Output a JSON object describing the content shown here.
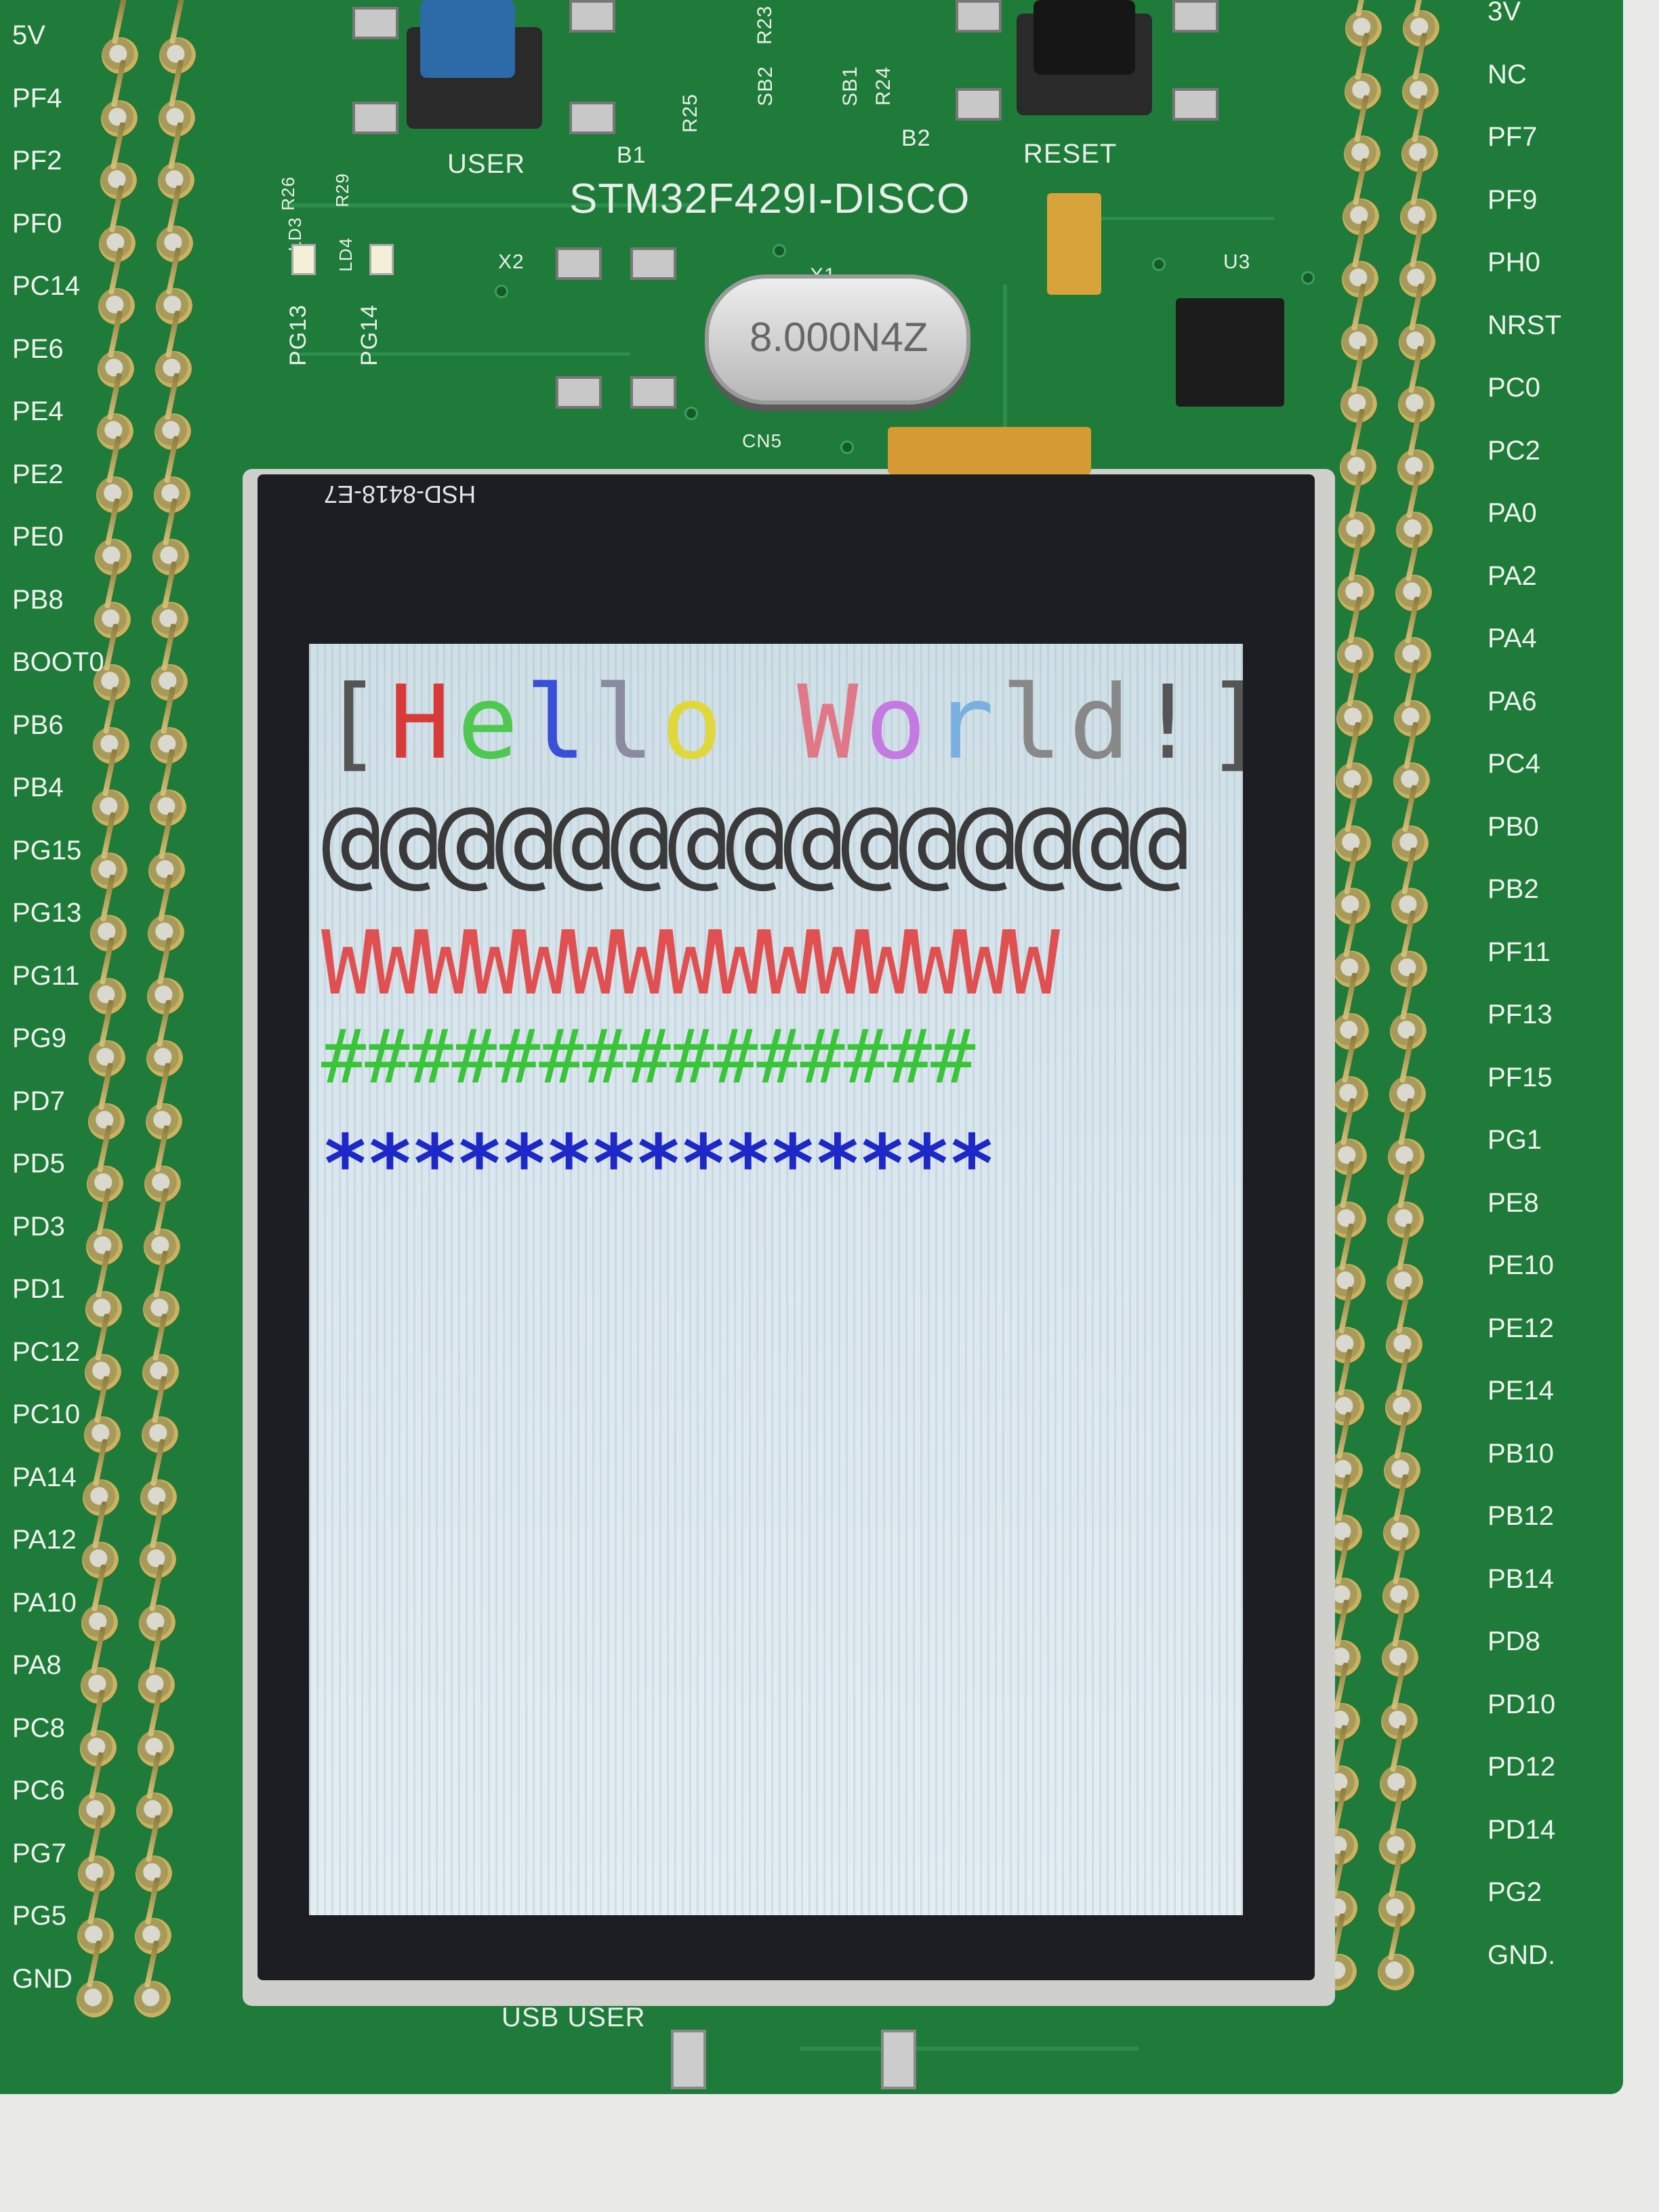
{
  "board": {
    "name": "STM32F429I-DISCO",
    "buttons": [
      "USER",
      "RESET"
    ],
    "button_ids": [
      "B1",
      "B2"
    ],
    "crystal": "8.000N4Z",
    "leds": [
      "LD3",
      "LD4"
    ],
    "led_labels": [
      "PG13",
      "PG14"
    ],
    "resistors": [
      "R26",
      "R23",
      "R25",
      "SB2",
      "SB1",
      "R24",
      "R29"
    ],
    "xtal_labels": [
      "X2",
      "X1"
    ],
    "chip_label": "U3",
    "connector": "CN5",
    "usb_label": "USB USER",
    "lcd_model": "HSD-8418-E7",
    "colors": {
      "pcb": "#1f7b3a",
      "silk": "#e8efe9",
      "gold": "#ccb260"
    }
  },
  "left_header": {
    "labels": [
      "5V",
      "PF4",
      "PF2",
      "PF0",
      "PC14",
      "PE6",
      "PE4",
      "PE2",
      "PE0",
      "PB8",
      "BOOT0",
      "PB6",
      "PB4",
      "PG15",
      "PG13",
      "PG11",
      "PG9",
      "PD7",
      "PD5",
      "PD3",
      "PD1",
      "PC12",
      "PC10",
      "PA14",
      "PA12",
      "PA10",
      "PA8",
      "PC8",
      "PC6",
      "PG7",
      "PG5",
      "GND"
    ]
  },
  "right_header": {
    "labels": [
      "3V",
      "NC",
      "PF7",
      "PF9",
      "PH0",
      "NRST",
      "PC0",
      "PC2",
      "PA0",
      "PA2",
      "PA4",
      "PA6",
      "PC4",
      "PB0",
      "PB2",
      "PF11",
      "PF13",
      "PF15",
      "PG1",
      "PE8",
      "PE10",
      "PE12",
      "PE14",
      "PB10",
      "PB12",
      "PB14",
      "PD8",
      "PD10",
      "PD12",
      "PD14",
      "PG2",
      "GND."
    ]
  },
  "display": {
    "hello_line": {
      "text_parts": [
        {
          "t": "[",
          "color": "#555555"
        },
        {
          "t": "H",
          "color": "#d83a3a"
        },
        {
          "t": "e",
          "color": "#4fc84f"
        },
        {
          "t": "l",
          "color": "#3a4fd8"
        },
        {
          "t": "l",
          "color": "#8a8aa0"
        },
        {
          "t": "o",
          "color": "#e0d83a"
        },
        {
          "t": " ",
          "color": "#000000"
        },
        {
          "t": "W",
          "color": "#e07888"
        },
        {
          "t": "o",
          "color": "#c47ae0"
        },
        {
          "t": "r",
          "color": "#7ab0e0"
        },
        {
          "t": "l",
          "color": "#888888"
        },
        {
          "t": "d",
          "color": "#888888"
        },
        {
          "t": "!",
          "color": "#555555"
        },
        {
          "t": "]",
          "color": "#555555"
        }
      ]
    },
    "line_at": "@@@@@@@@@@@@@@@",
    "line_w": "WWWWWWWWWWWWWWW",
    "line_hash": "###############",
    "line_star": "***************"
  }
}
